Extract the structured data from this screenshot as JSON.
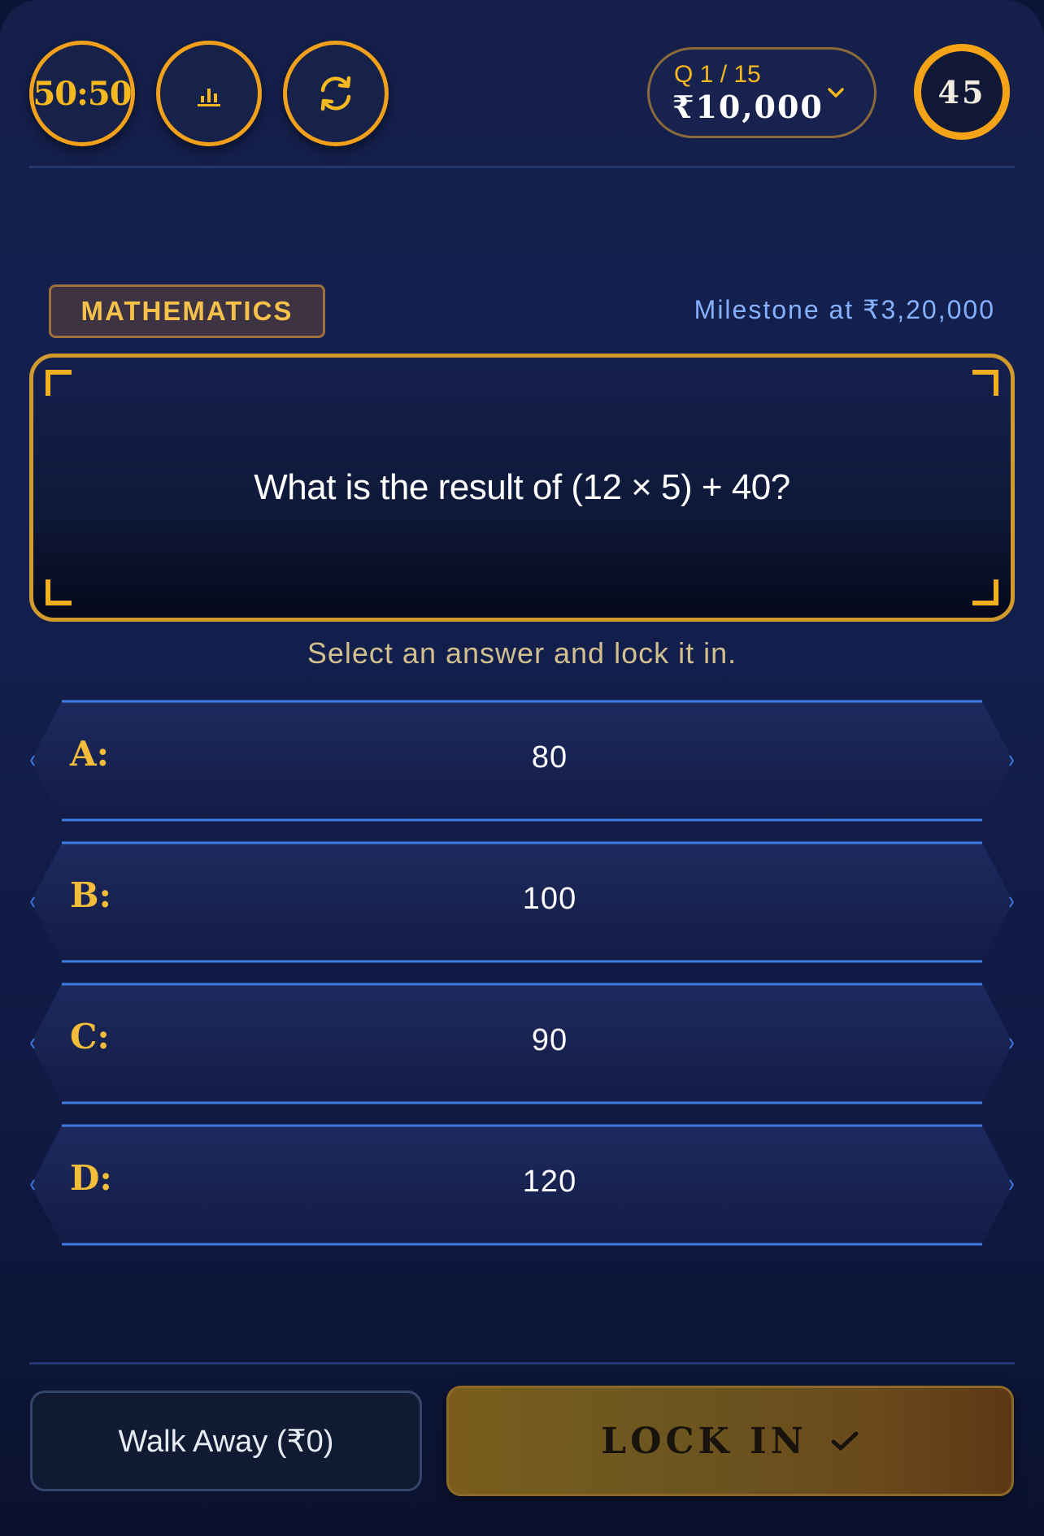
{
  "lifelines": [
    {
      "label": "50:50",
      "icon": "fifty-fifty-icon"
    },
    {
      "label": "",
      "icon": "audience-poll-icon"
    },
    {
      "label": "",
      "icon": "swap-question-icon"
    }
  ],
  "progress": {
    "question": "Q 1 / 15",
    "amount": "₹10,000"
  },
  "timer": {
    "seconds": "45"
  },
  "category": "MATHEMATICS",
  "milestone": "Milestone at ₹3,20,000",
  "question": "What is the result of (12 × 5) + 40?",
  "hint": "Select an answer and lock it in.",
  "answers": [
    {
      "letter": "A:",
      "value": "80"
    },
    {
      "letter": "B:",
      "value": "100"
    },
    {
      "letter": "C:",
      "value": "90"
    },
    {
      "letter": "D:",
      "value": "120"
    }
  ],
  "walk_away": "Walk Away (₹0)",
  "lock_in": "LOCK IN",
  "colors": {
    "accent": "#f0a01a",
    "answer_border": "#3f7ae0",
    "question_border": "#d09a2c"
  }
}
